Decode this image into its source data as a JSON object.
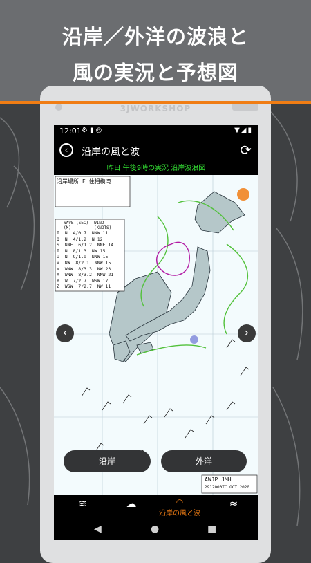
{
  "promo": {
    "headline_line1": "沿岸／外洋の波浪と",
    "headline_line2": "風の実況と予想図",
    "accent_color": "#f07d14"
  },
  "device": {
    "brand": "3JWORKSHOP"
  },
  "statusbar": {
    "time": "12:01",
    "icons_left": [
      "gear-icon",
      "sim-icon",
      "at-icon"
    ],
    "icons_right": [
      "wifi-icon",
      "signal-icon",
      "battery-icon"
    ]
  },
  "appbar": {
    "title": "沿岸の風と波"
  },
  "caption": "昨日 午後9時の実況 沿岸波浪図",
  "map": {
    "table_title": "沿岸場所 F 住相模湾",
    "table_head": [
      "WAVE (SEC)(M)",
      "WIND (KNOTS)"
    ],
    "stations": [
      [
        "T",
        "N",
        "4/0.7",
        "NNW 11"
      ],
      [
        "Q",
        "N",
        "4/1.2",
        "N 12"
      ],
      [
        "S",
        "NNE",
        "6/1.2",
        "NNE 14"
      ],
      [
        "T",
        "N",
        "8/1.3",
        "NW 15"
      ],
      [
        "U",
        "N",
        "9/1.9",
        "NNW 15"
      ],
      [
        "V",
        "NW",
        "8/2.1",
        "NNW 15"
      ],
      [
        "W",
        "WNW",
        "8/3.3",
        "NW 23"
      ],
      [
        "X",
        "WNW",
        "8/3.2",
        "NNW 21"
      ],
      [
        "Y",
        "W",
        "7/2.7",
        "WSW 17"
      ],
      [
        "Z",
        "WSW",
        "7/2.7",
        "NW 11"
      ]
    ],
    "footer_code": "AWJP JMH",
    "footer_time": "2912000TC OCT 2020"
  },
  "tabs": {
    "coastal": "沿岸",
    "offshore": "外洋"
  },
  "bottomnav": {
    "items": [
      "weather-map-icon",
      "sun-cloud-icon",
      "coastal-wave-icon",
      "ocean-wave-icon"
    ],
    "active_label": "沿岸の風と波"
  }
}
